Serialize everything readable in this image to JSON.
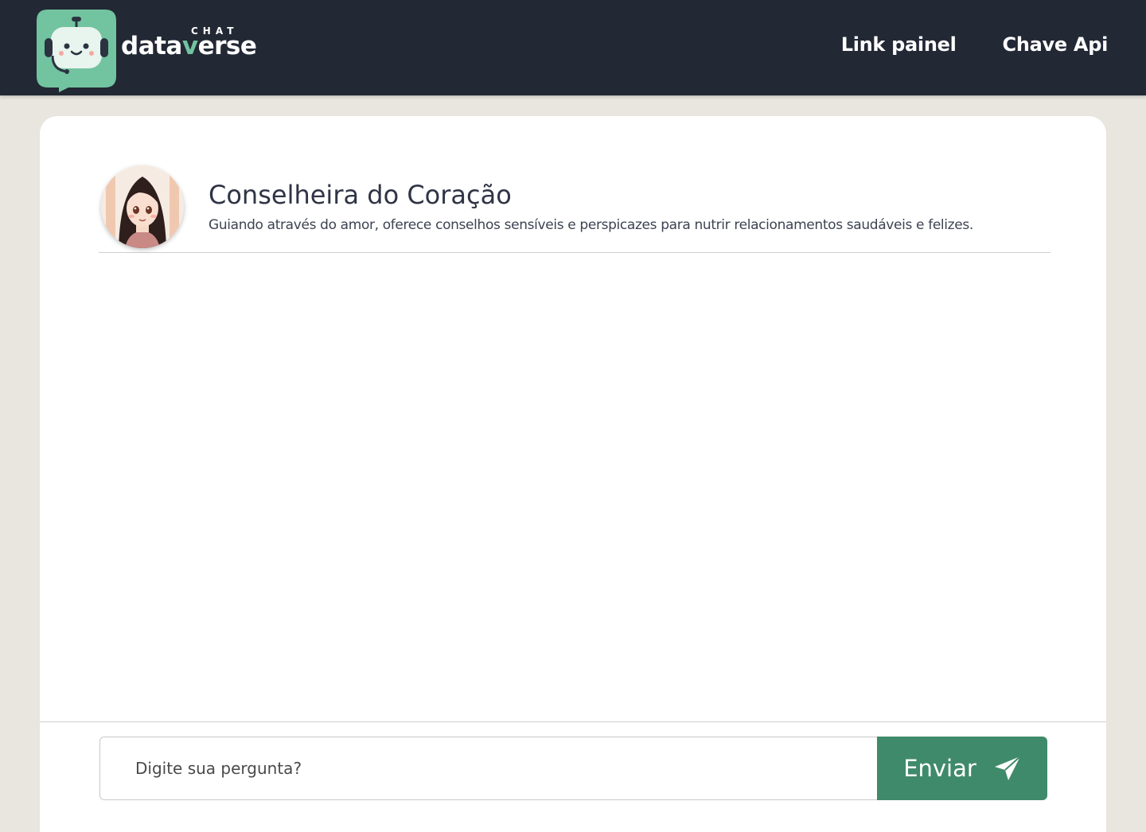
{
  "app": {
    "logo_small": "CHAT",
    "logo_word_start": "data",
    "logo_word_accent": "v",
    "logo_word_end": "erse",
    "brand_color": "#72c3a0",
    "header_color": "#222834"
  },
  "nav": {
    "items": [
      {
        "label": "Link painel"
      },
      {
        "label": "Chave Api"
      }
    ]
  },
  "assistant": {
    "name": "Conselheira do Coração",
    "description": "Guiando através do amor, oferece conselhos sensíveis e perspicazes para nutrir relacionamentos saudáveis e felizes.",
    "avatar_icon": "woman-portrait-avatar"
  },
  "composer": {
    "placeholder": "Digite sua pergunta?",
    "value": "",
    "send_label": "Enviar",
    "send_icon": "paper-plane-icon",
    "send_color": "#3f8a6a"
  }
}
